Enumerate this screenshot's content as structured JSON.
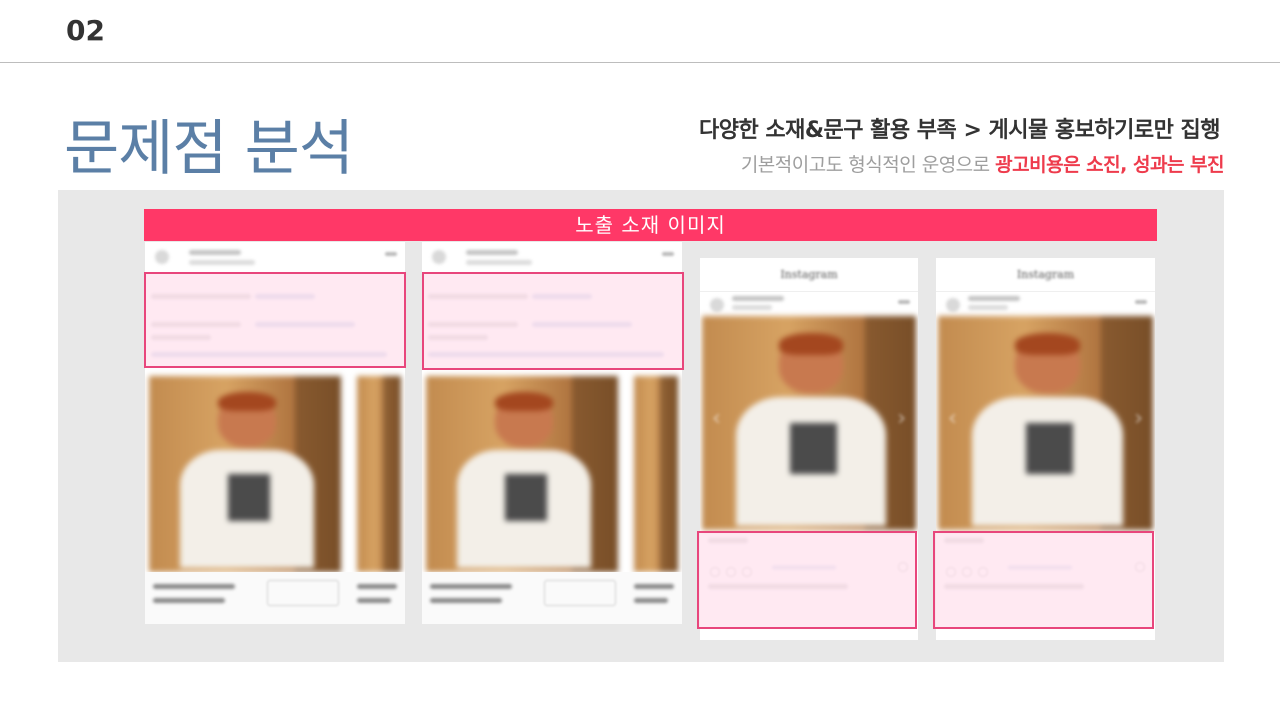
{
  "header": {
    "slide_number": "02"
  },
  "title": "문제점 분석",
  "headline": "다양한 소재&문구 활용 부족 > 게시물 홍보하기로만 집행",
  "subline": {
    "prefix": "기본적이고도 형식적인 운영으로 ",
    "highlight": "광고비용은 소진, 성과는 부진"
  },
  "banner": "노출 소재 이미지",
  "instagram_logo": "Instagram",
  "colors": {
    "title": "#5b7fa6",
    "banner": "#ff3867",
    "highlight": "#ee3b4c",
    "box_border": "#e8467c",
    "panel": "#e8e8e8"
  }
}
